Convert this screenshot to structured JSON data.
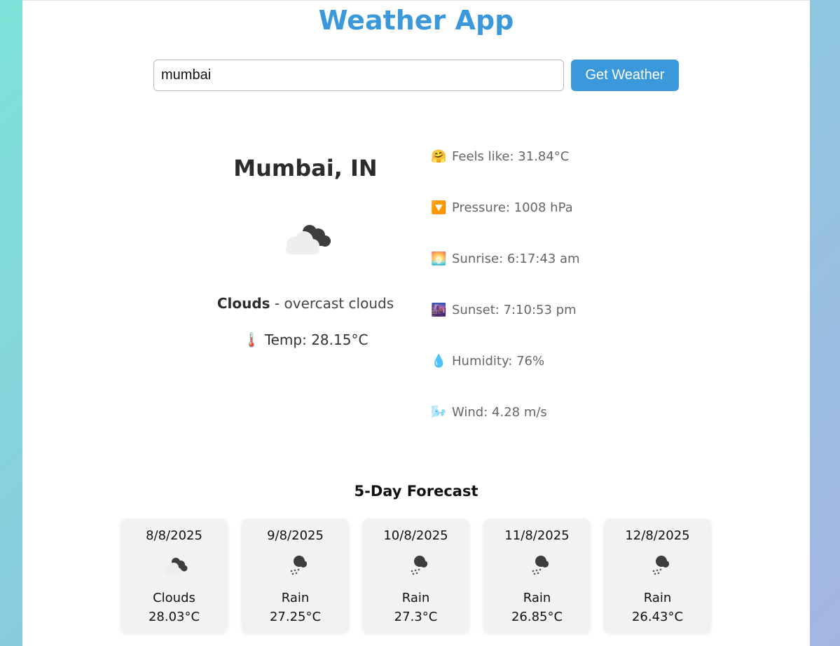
{
  "app": {
    "title": "Weather App"
  },
  "search": {
    "value": "mumbai",
    "button_label": "Get Weather"
  },
  "current": {
    "location": "Mumbai, IN",
    "icon": "overcast-clouds-icon",
    "condition": "Clouds",
    "separator": " - ",
    "description": "overcast clouds",
    "temp_label": "Temp: 28.15°C",
    "temp_emoji": "🌡️"
  },
  "details": [
    {
      "emoji": "🤗",
      "label": "Feels like: 31.84°C",
      "icon": "feels-like-icon"
    },
    {
      "emoji": "🔽",
      "label": "Pressure: 1008 hPa",
      "icon": "pressure-icon"
    },
    {
      "emoji": "🌅",
      "label": "Sunrise: 6:17:43 am",
      "icon": "sunrise-icon"
    },
    {
      "emoji": "🌆",
      "label": "Sunset: 7:10:53 pm",
      "icon": "sunset-icon"
    },
    {
      "emoji": "💧",
      "label": "Humidity: 76%",
      "icon": "humidity-icon"
    },
    {
      "emoji": "🌬️",
      "label": "Wind: 4.28 m/s",
      "icon": "wind-icon"
    }
  ],
  "forecast": {
    "title": "5-Day Forecast",
    "days": [
      {
        "date": "8/8/2025",
        "condition": "Clouds",
        "temp": "28.03°C",
        "icon": "cloud-icon"
      },
      {
        "date": "9/8/2025",
        "condition": "Rain",
        "temp": "27.25°C",
        "icon": "rain-icon"
      },
      {
        "date": "10/8/2025",
        "condition": "Rain",
        "temp": "27.3°C",
        "icon": "rain-icon"
      },
      {
        "date": "11/8/2025",
        "condition": "Rain",
        "temp": "26.85°C",
        "icon": "rain-icon"
      },
      {
        "date": "12/8/2025",
        "condition": "Rain",
        "temp": "26.43°C",
        "icon": "rain-icon"
      }
    ]
  },
  "colors": {
    "accent": "#3a98db",
    "card_bg": "#f1f2f4"
  }
}
